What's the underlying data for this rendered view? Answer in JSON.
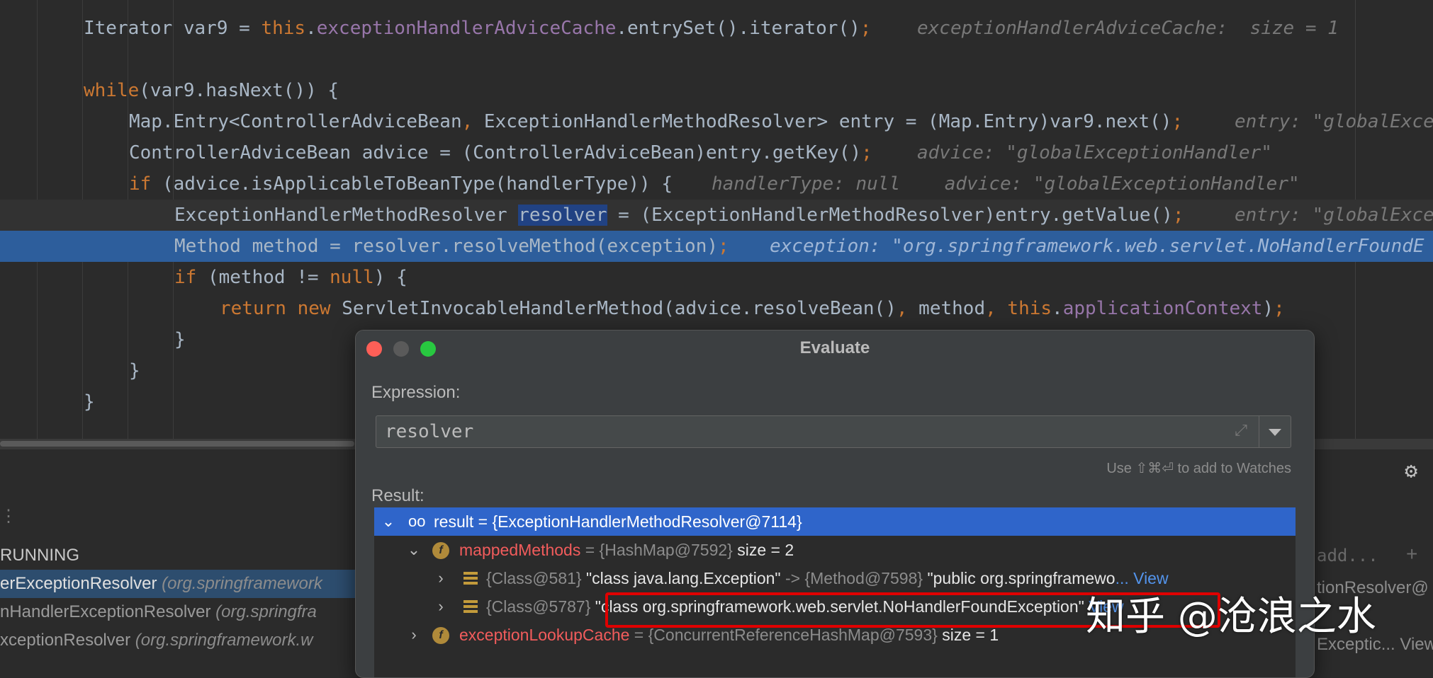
{
  "editor": {
    "lines": [
      {
        "id": "l1",
        "parts": [
          [
            "",
            "Iterator var9 = "
          ],
          [
            "kw",
            "this"
          ],
          [
            "",
            "."
          ],
          [
            "fld",
            "exceptionHandlerAdviceCache"
          ],
          [
            "",
            ".entrySet().iterator()"
          ],
          [
            "kw",
            ";"
          ]
        ],
        "hint": "exceptionHandlerAdviceCache:  size = 1"
      },
      {
        "id": "l2",
        "parts": [],
        "hint": ""
      },
      {
        "id": "l3",
        "parts": [
          [
            "kw",
            "while"
          ],
          [
            "",
            "(var9.hasNext()) {"
          ]
        ],
        "hint": ""
      },
      {
        "id": "l4",
        "parts": [
          [
            "",
            "Map.Entry<ControllerAdviceBean"
          ],
          [
            "kw",
            ","
          ],
          [
            "",
            " ExceptionHandlerMethodResolver> entry = (Map.Entry)var9.next()"
          ],
          [
            "kw",
            ";"
          ]
        ],
        "hint": "entry: \"globalExce"
      },
      {
        "id": "l5",
        "parts": [
          [
            "",
            "ControllerAdviceBean advice = (ControllerAdviceBean)entry.getKey()"
          ],
          [
            "kw",
            ";"
          ]
        ],
        "hint": "advice: \"globalExceptionHandler\""
      },
      {
        "id": "l6",
        "parts": [
          [
            "kw",
            "if"
          ],
          [
            "",
            " (advice.isApplicableToBeanType(handlerType)) {"
          ]
        ],
        "hint": "handlerType: null    advice: \"globalExceptionHandler\""
      },
      {
        "id": "l7",
        "parts": [
          [
            "",
            "ExceptionHandlerMethodResolver "
          ],
          [
            "sel",
            "resolver"
          ],
          [
            "",
            " = (ExceptionHandlerMethodResolver)entry.getValue()"
          ],
          [
            "kw",
            ";"
          ]
        ],
        "hint": "entry: \"globalExce"
      },
      {
        "id": "l8",
        "parts": [
          [
            "",
            "Method method = resolver.resolveMethod(exception)"
          ],
          [
            "kw",
            ";"
          ]
        ],
        "hint": "exception: \"org.springframework.web.servlet.NoHandlerFoundE"
      },
      {
        "id": "l9",
        "parts": [
          [
            "kw",
            "if"
          ],
          [
            "",
            " (method != "
          ],
          [
            "kw",
            "null"
          ],
          [
            "",
            ") {"
          ]
        ],
        "hint": ""
      },
      {
        "id": "l10",
        "parts": [
          [
            "kw",
            "return new"
          ],
          [
            "",
            " ServletInvocableHandlerMethod(advice.resolveBean()"
          ],
          [
            "kw",
            ","
          ],
          [
            "",
            " method"
          ],
          [
            "kw",
            ", this"
          ],
          [
            "",
            "."
          ],
          [
            "fld",
            "applicationContext"
          ],
          [
            "",
            ")"
          ],
          [
            "kw",
            ";"
          ]
        ],
        "hint": ""
      },
      {
        "id": "l11",
        "parts": [
          [
            "",
            "}"
          ]
        ],
        "hint": ""
      },
      {
        "id": "l12",
        "parts": [
          [
            "",
            "}"
          ]
        ],
        "hint": ""
      },
      {
        "id": "l13",
        "parts": [
          [
            "",
            "}"
          ]
        ],
        "hint": ""
      }
    ]
  },
  "panel": {
    "status": "RUNNING",
    "frames": [
      {
        "name": "erExceptionResolver ",
        "pkg": "(org.springframework"
      },
      {
        "name": "nHandlerExceptionResolver ",
        "pkg": "(org.springfra"
      },
      {
        "name": "xceptionResolver ",
        "pkg": "(org.springframework.w"
      }
    ],
    "right_add": "add...",
    "right_row1": "tionResolver@",
    "right_row3": "Exceptic... View"
  },
  "dialog": {
    "title": "Evaluate",
    "expression_label": "Expression:",
    "expression_value": "resolver",
    "watch_hint": "Use ⇧⌘⏎ to add to Watches",
    "result_label": "Result:",
    "tree": {
      "root": {
        "name": "result",
        "value": " = {ExceptionHandlerMethodResolver@7114}"
      },
      "mapped": {
        "name": "mappedMethods",
        "ref": " = {HashMap@7592}",
        "extra": "  size = 2"
      },
      "entry1": {
        "key": "{Class@581}",
        "key_str": " \"class java.lang.Exception\"",
        "arrow": " -> {Method@7598}",
        "val": " \"public org.springframewo",
        "more": "... View"
      },
      "entry2": {
        "key": "{Class@5787}",
        "key_str": " \"class org.springframework.web.servlet.NoHandlerFoundException\"",
        "arrow": "",
        "val": "",
        "more": " View"
      },
      "cache": {
        "name": "exceptionLookupCache",
        "ref": " = {ConcurrentReferenceHashMap@7593}",
        "extra": "  size = 1"
      }
    }
  },
  "watermark": "知乎 @沧浪之水",
  "colors": {
    "exec_line": "#2d5e9c",
    "selection": "#2f65ca",
    "highlight_box": "#e00000"
  }
}
